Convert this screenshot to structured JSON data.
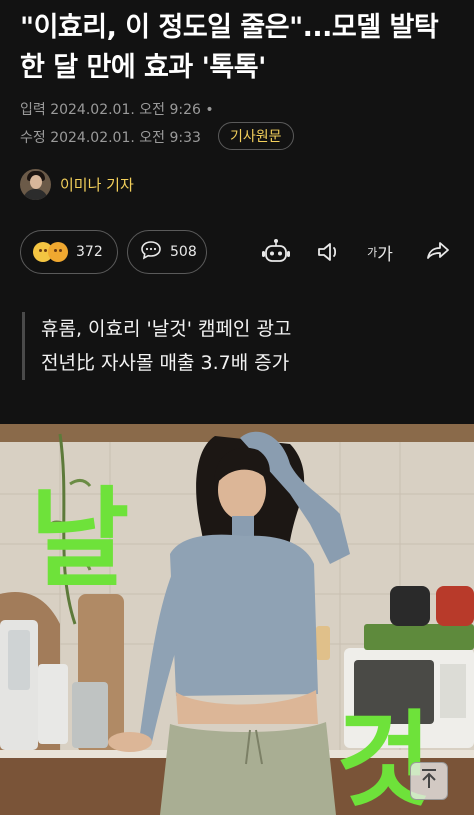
{
  "article": {
    "headline": "\"이효리, 이 정도일 줄은\"...모델 발탁 한 달 만에 효과 '톡톡'",
    "published": "입력 2024.02.01. 오전 9:26",
    "modified": "수정 2024.02.01. 오전 9:33",
    "original_label": "기사원문",
    "author": "이미나 기자",
    "summary": [
      "휴롬, 이효리 '날것' 캠페인 광고",
      "전년比 자사몰 매출 3.7배 증가"
    ]
  },
  "reactions": {
    "count": "372"
  },
  "comments": {
    "count": "508"
  },
  "toolbar": {
    "icons": [
      "robot-summary-icon",
      "speaker-icon",
      "font-size-icon",
      "share-icon"
    ],
    "font_size_label_small": "가",
    "font_size_label_large": "가"
  },
  "photo": {
    "overlay_text_top": "날",
    "overlay_text_bottom": "것",
    "overlay_color": "#6ee23a"
  },
  "scroll_top": {
    "icon": "arrow-up-icon"
  },
  "colors": {
    "accent": "#f2cf5b",
    "background": "#121212"
  }
}
